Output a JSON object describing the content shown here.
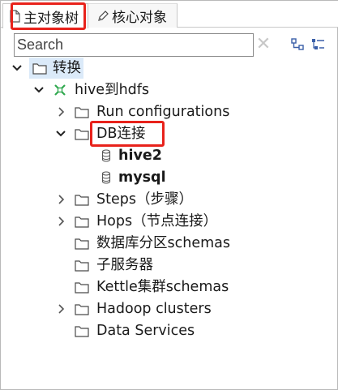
{
  "tabs": [
    {
      "label": "主对象树",
      "icon": "document-icon",
      "active": true
    },
    {
      "label": "核心对象",
      "icon": "pencil-icon",
      "active": false
    }
  ],
  "search": {
    "placeholder": "Search",
    "value": ""
  },
  "toolbar": {
    "clear_icon": "close-icon",
    "collapse_icon": "tree-collapse-icon",
    "expand_icon": "tree-expand-icon"
  },
  "tree": {
    "root": {
      "label": "转换",
      "icon": "folder-icon",
      "expanded": true,
      "selected": true
    },
    "transformation": {
      "label": "hive到hdfs",
      "icon": "transformation-icon",
      "expanded": true
    },
    "run_configurations": {
      "label": "Run configurations",
      "expanded": false
    },
    "db_connections": {
      "label": "DB连接",
      "expanded": true
    },
    "connections": [
      {
        "label": "hive2",
        "icon": "database-icon"
      },
      {
        "label": "mysql",
        "icon": "database-icon"
      }
    ],
    "steps": {
      "label": "Steps（步骤）",
      "expanded": false
    },
    "hops": {
      "label": "Hops（节点连接）",
      "expanded": false
    },
    "partition_schemas": {
      "label": "数据库分区schemas"
    },
    "slave_servers": {
      "label": "子服务器"
    },
    "kettle_cluster_schemas": {
      "label": "Kettle集群schemas"
    },
    "hadoop_clusters": {
      "label": "Hadoop clusters",
      "expanded": false
    },
    "data_services": {
      "label": "Data Services"
    }
  },
  "colors": {
    "highlight_box": "#e8221b",
    "selection": "#dbeaf9",
    "transformation_icon": "#2fa84f"
  }
}
